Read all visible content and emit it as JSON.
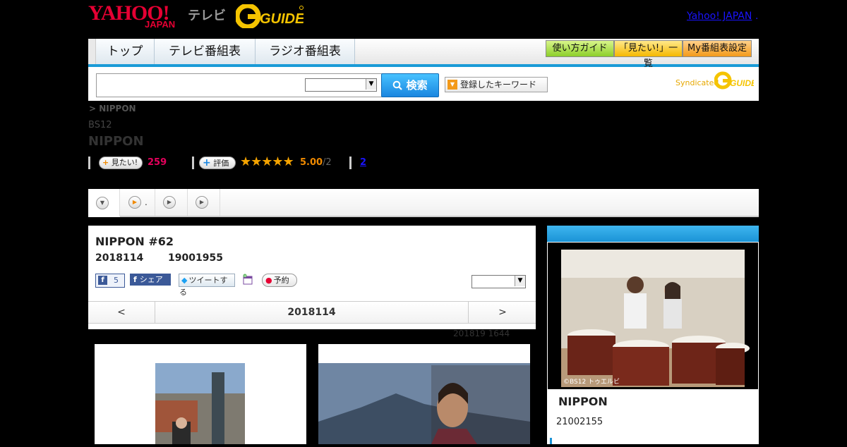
{
  "header": {
    "logo_yahoo": "YAHOO!",
    "logo_japan": "JAPAN",
    "logo_tv": "テレビ",
    "logo_gguide": "G-GUIDE",
    "yahoo_japan_link": "Yahoo! JAPAN",
    "link_dot": "."
  },
  "nav": {
    "tabs": [
      "トップ",
      "テレビ番組表",
      "ラジオ番組表"
    ],
    "buttons": [
      "使い方ガイド",
      "「見たい!」一覧",
      "My番組表設定"
    ]
  },
  "search": {
    "button_label": "検索",
    "keyword_button": "登録したキーワード",
    "syndicated_label": "Syndicated"
  },
  "program": {
    "breadcrumb": "> NIPPON",
    "channel": "BS12",
    "title": "NIPPON",
    "want_label": "見たい!",
    "want_count": "259",
    "rate_label": "評価",
    "stars": "★★★★★",
    "score": "5.00",
    "score_count": "/2",
    "review_link": "2"
  },
  "tabs": {
    "items": [
      {
        "icon": "chevron-down-icon",
        "label": ""
      },
      {
        "icon": "play-icon",
        "label": "."
      },
      {
        "icon": "play-icon",
        "label": ""
      },
      {
        "icon": "play-icon",
        "label": ""
      }
    ]
  },
  "episode": {
    "title": "NIPPON #62",
    "date": "2018114",
    "time": "19001955",
    "fb_like_count": "5",
    "fb_share_label": "シェア",
    "tweet_label": "ツイートする",
    "reserve_label": "予約",
    "nav_prev": "<",
    "nav_date": "2018114",
    "nav_next": ">",
    "updated": "201819  1644"
  },
  "sidebar": {
    "image_credit": "©BS12 トゥエルビ",
    "title": "NIPPON",
    "time": "21002155"
  },
  "colors": {
    "brand_red": "#e60033",
    "accent_blue": "#1a9bd7",
    "star": "#f4a300",
    "pink_count": "#e6005c",
    "gguide_yellow": "#f5c400"
  }
}
